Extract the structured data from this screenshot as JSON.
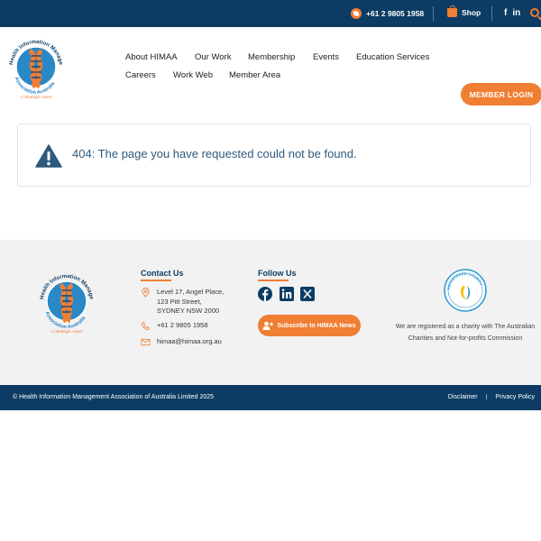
{
  "topbar": {
    "phone": "+61 2 9805 1958",
    "shop_label": "Shop",
    "social": {
      "facebook": "f",
      "linkedin": "in"
    },
    "icons": [
      "phone-icon",
      "shopping-bag-icon",
      "facebook-icon",
      "linkedin-icon",
      "search-icon"
    ]
  },
  "logo": {
    "name": "Health Information Management Association Australia",
    "tagline": "A Strategic Asset"
  },
  "nav": {
    "items": [
      "About HIMAA",
      "Our Work",
      "Membership",
      "Events",
      "Education Services",
      "Careers",
      "Work Web",
      "Member Area"
    ]
  },
  "header": {
    "login_label": "MEMBER LOGIN"
  },
  "alert": {
    "message": "404: The page you have requested could not be found."
  },
  "footer": {
    "contact": {
      "heading": "Contact Us",
      "address_lines": [
        "Level 17, Angel Place,",
        "123 Pitt Street,",
        "SYDNEY NSW 2000"
      ],
      "phone": "+61 2 9805 1958",
      "email": "himaa@himaa.org.au"
    },
    "follow": {
      "heading": "Follow Us",
      "subscribe_label": "Subscribe to HIMAA News"
    },
    "charity": {
      "badge_text": "REGISTERED CHARITY",
      "text": "We are registered as a charity with The Australian Charities and Not-for-profits Commission"
    }
  },
  "bottombar": {
    "copyright": "© Health Information Management Association of Australia Limited 2025",
    "links": [
      "Disclaimer",
      "Privacy Policy"
    ],
    "separator": "|"
  },
  "colors": {
    "navy": "#0c3c64",
    "orange": "#f07e33",
    "footer_bg": "#f2f2f2"
  }
}
